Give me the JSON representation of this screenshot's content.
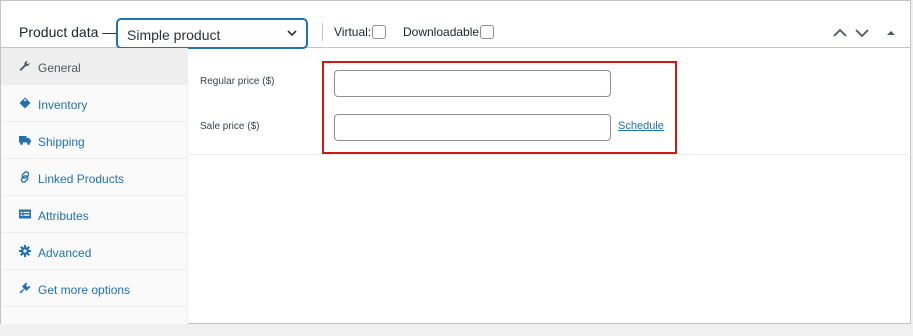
{
  "header": {
    "title": "Product data —",
    "product_type": "Simple product",
    "virtual_label": "Virtual:",
    "downloadable_label": "Downloadable:"
  },
  "sidebar": {
    "items": [
      {
        "label": "General",
        "icon": "wrench-icon",
        "active": true
      },
      {
        "label": "Inventory",
        "icon": "tag-icon",
        "active": false
      },
      {
        "label": "Shipping",
        "icon": "truck-icon",
        "active": false
      },
      {
        "label": "Linked Products",
        "icon": "link-icon",
        "active": false
      },
      {
        "label": "Attributes",
        "icon": "list-icon",
        "active": false
      },
      {
        "label": "Advanced",
        "icon": "gear-icon",
        "active": false
      },
      {
        "label": "Get more options",
        "icon": "plugin-icon",
        "active": false
      }
    ]
  },
  "general": {
    "regular_price_label": "Regular price ($)",
    "regular_price_value": "",
    "sale_price_label": "Sale price ($)",
    "sale_price_value": "",
    "schedule_link": "Schedule"
  },
  "colors": {
    "accent": "#2271b1",
    "highlight": "#cc1818"
  }
}
